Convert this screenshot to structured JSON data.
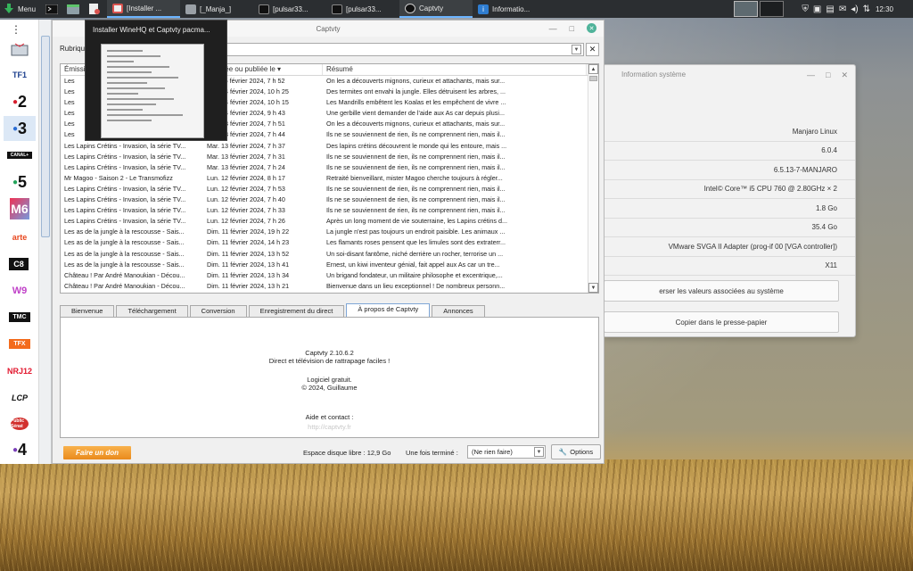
{
  "panel": {
    "menu_label": "Menu",
    "tasks": [
      {
        "label": "[Installer ...",
        "icon_color": "#d9534f",
        "active": true
      },
      {
        "label": "[_Manja_]",
        "icon_color": "#9aa0a6",
        "active": false
      },
      {
        "label": "[pulsar33...",
        "icon_color": "#222222",
        "active": false
      },
      {
        "label": "[pulsar33...",
        "icon_color": "#222222",
        "active": false
      },
      {
        "label": "Captvty",
        "icon_color": "#222222",
        "active": true
      },
      {
        "label": "Informatio...",
        "icon_color": "#2f7dd1",
        "active": false
      }
    ],
    "clock": "12:30"
  },
  "tooltip": {
    "title": "Installer WineHQ et Captvty pacma..."
  },
  "channels": [
    "TF1",
    "2",
    "3",
    "CANAL+",
    "5",
    "M6",
    "arte",
    "C8",
    "W9",
    "TMC",
    "TFX",
    "NRJ12",
    "LCP",
    "Public Sénat",
    "4"
  ],
  "captvty": {
    "title": "Captvty",
    "rubrique_label": "Rubrique",
    "columns": {
      "emission": "Émission",
      "date": "Diffusée ou publiée le",
      "resume": "Résumé"
    },
    "rows": [
      {
        "e": "Les",
        "d": "Jeu. 15 février 2024, 7 h 52",
        "r": "On les a découverts mignons, curieux et attachants, mais sur..."
      },
      {
        "e": "Les",
        "d": "Mer. 14 février 2024, 10 h 25",
        "r": "Des termites ont envahi la jungle. Elles détruisent les arbres, ..."
      },
      {
        "e": "Les",
        "d": "Mer. 14 février 2024, 10 h 15",
        "r": "Les Mandrills embêtent les Koalas et les empêchent de vivre ..."
      },
      {
        "e": "Les",
        "d": "Mer. 14 février 2024, 9 h 43",
        "r": "Une gerbille vient demander de l'aide aux As car depuis plusi..."
      },
      {
        "e": "Les",
        "d": "Mar. 13 février 2024, 7 h 51",
        "r": "On les a découverts mignons, curieux et attachants, mais sur..."
      },
      {
        "e": "Les",
        "d": "Mar. 13 février 2024, 7 h 44",
        "r": "Ils ne se souviennent de rien, ils ne comprennent rien, mais il..."
      },
      {
        "e": "Les Lapins Crétins - Invasion, la série TV...",
        "d": "Mar. 13 février 2024, 7 h 37",
        "r": "Des lapins crétins découvrent le monde qui les entoure, mais ..."
      },
      {
        "e": "Les Lapins Crétins - Invasion, la série TV...",
        "d": "Mar. 13 février 2024, 7 h 31",
        "r": "Ils ne se souviennent de rien, ils ne comprennent rien, mais il..."
      },
      {
        "e": "Les Lapins Crétins - Invasion, la série TV...",
        "d": "Mar. 13 février 2024, 7 h 24",
        "r": "Ils ne se souviennent de rien, ils ne comprennent rien, mais il..."
      },
      {
        "e": "Mr Magoo - Saison 2 - Le Transmofizz",
        "d": "Lun. 12 février 2024, 8 h 17",
        "r": "Retraité bienveillant, mister Magoo cherche toujours à régler..."
      },
      {
        "e": "Les Lapins Crétins - Invasion, la série TV...",
        "d": "Lun. 12 février 2024, 7 h 53",
        "r": "Ils ne se souviennent de rien, ils ne comprennent rien, mais il..."
      },
      {
        "e": "Les Lapins Crétins - Invasion, la série TV...",
        "d": "Lun. 12 février 2024, 7 h 40",
        "r": "Ils ne se souviennent de rien, ils ne comprennent rien, mais il..."
      },
      {
        "e": "Les Lapins Crétins - Invasion, la série TV...",
        "d": "Lun. 12 février 2024, 7 h 33",
        "r": "Ils ne se souviennent de rien, ils ne comprennent rien, mais il..."
      },
      {
        "e": "Les Lapins Crétins - Invasion, la série TV...",
        "d": "Lun. 12 février 2024, 7 h 26",
        "r": "Après un long moment de vie souterraine, les Lapins crétins d..."
      },
      {
        "e": "Les as de la jungle à la rescousse - Sais...",
        "d": "Dim. 11 février 2024, 19 h 22",
        "r": "La jungle n'est pas toujours un endroit paisible. Les animaux ..."
      },
      {
        "e": "Les as de la jungle à la rescousse - Sais...",
        "d": "Dim. 11 février 2024, 14 h 23",
        "r": "Les flamants roses pensent que les limules sont des extraterr..."
      },
      {
        "e": "Les as de la jungle à la rescousse - Sais...",
        "d": "Dim. 11 février 2024, 13 h 52",
        "r": "Un soi-disant fantôme, niché derrière un rocher, terrorise un ..."
      },
      {
        "e": "Les as de la jungle à la rescousse - Sais...",
        "d": "Dim. 11 février 2024, 13 h 41",
        "r": "Ernest, un kiwi inventeur génial, fait appel aux As car un tre..."
      },
      {
        "e": "Château ! Par André Manoukian - Décou...",
        "d": "Dim. 11 février 2024, 13 h 34",
        "r": "Un brigand fondateur, un militaire philosophe et excentrique,..."
      },
      {
        "e": "Château ! Par André Manoukian - Décou...",
        "d": "Dim. 11 février 2024, 13 h 21",
        "r": "Bienvenue dans un lieu exceptionnel ! De nombreux personn..."
      }
    ],
    "tabs": [
      "Bienvenue",
      "Téléchargement",
      "Conversion",
      "Enregistrement du direct",
      "À propos de Captvty",
      "Annonces"
    ],
    "selected_tab": 4,
    "about": {
      "version": "Captvty 2.10.6.2",
      "tagline": "Direct et télévision de rattrapage faciles !",
      "license": "Logiciel gratuit.",
      "copyright": "© 2024, Guillaume",
      "help": "Aide et contact :",
      "link": "http://captvty.fr"
    },
    "donate_label": "Faire un don",
    "disk_label": "Espace disque libre : 12,9 Go",
    "when_label": "Une fois terminé :",
    "when_value": "(Ne rien faire)",
    "options_label": "Options"
  },
  "sysinfo": {
    "title": "Information système",
    "rows": [
      "Manjaro Linux",
      "6.0.4",
      "6.5.13-7-MANJARO",
      "Intel© Core™ i5 CPU     760  @ 2.80GHz × 2",
      "1.8 Go",
      "35.4 Go",
      "VMware SVGA II Adapter (prog-if 00 [VGA controller])",
      "X11"
    ],
    "button1": "erser les valeurs associées au système",
    "button2": "Copier dans le presse-papier"
  }
}
